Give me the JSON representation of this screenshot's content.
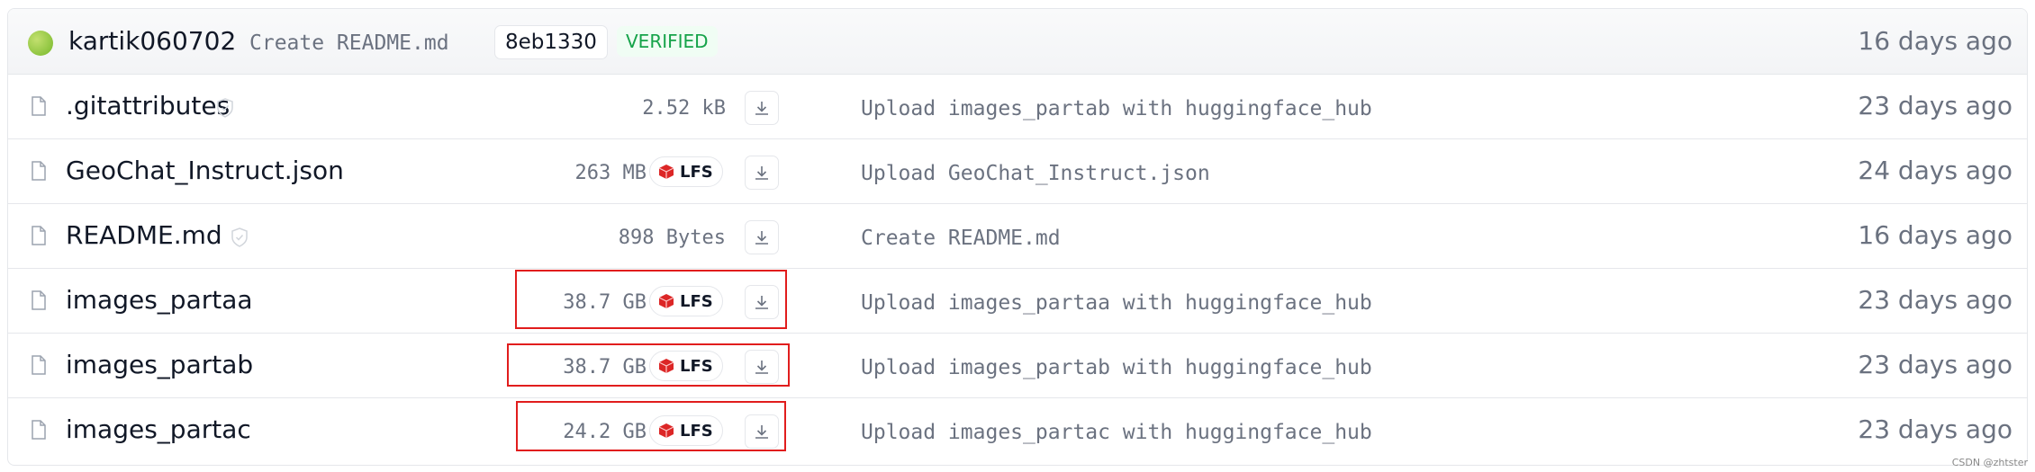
{
  "latest_commit": {
    "author": "kartik060702",
    "message": "Create README.md",
    "sha": "8eb1330",
    "badge": "VERIFIED",
    "time": "16 days ago"
  },
  "files": [
    {
      "name": ".gitattributes",
      "safe": true,
      "size": "2.52 kB",
      "lfs": false,
      "commit_message": "Upload images_partab with huggingface_hub",
      "time": "23 days ago"
    },
    {
      "name": "GeoChat_Instruct.json",
      "safe": false,
      "size": "263 MB",
      "lfs": true,
      "commit_message": "Upload GeoChat_Instruct.json",
      "time": "24 days ago"
    },
    {
      "name": "README.md",
      "safe": true,
      "size": "898 Bytes",
      "lfs": false,
      "commit_message": "Create README.md",
      "time": "16 days ago"
    },
    {
      "name": "images_partaa",
      "safe": false,
      "size": "38.7 GB",
      "lfs": true,
      "commit_message": "Upload images_partaa with huggingface_hub",
      "time": "23 days ago",
      "highlighted": true
    },
    {
      "name": "images_partab",
      "safe": false,
      "size": "38.7 GB",
      "lfs": true,
      "commit_message": "Upload images_partab with huggingface_hub",
      "time": "23 days ago",
      "highlighted": true
    },
    {
      "name": "images_partac",
      "safe": false,
      "size": "24.2 GB",
      "lfs": true,
      "commit_message": "Upload images_partac with huggingface_hub",
      "time": "23 days ago",
      "highlighted": true
    }
  ],
  "lfs_label": "LFS",
  "watermark": "CSDN @zhtster",
  "colors": {
    "highlight": "#e11d1d",
    "verified": "#16a34a",
    "lfs_icon": "#dc2626"
  }
}
